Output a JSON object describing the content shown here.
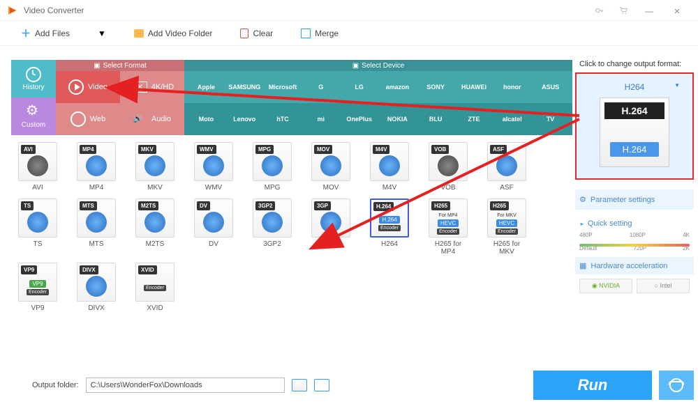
{
  "window": {
    "title": "Video Converter"
  },
  "toolbar": {
    "add_files": "Add Files",
    "add_folder": "Add Video Folder",
    "clear": "Clear",
    "merge": "Merge"
  },
  "sidebar": {
    "history": "History",
    "custom": "Custom"
  },
  "category_headers": {
    "format": "Select Format",
    "device": "Select Device"
  },
  "categories": {
    "video": "Video",
    "k4hd": "4K/HD",
    "web": "Web",
    "audio": "Audio"
  },
  "brands_row1": [
    "Apple",
    "SAMSUNG",
    "Microsoft",
    "G",
    "LG",
    "amazon",
    "SONY",
    "HUAWEI",
    "honor",
    "ASUS"
  ],
  "brands_row2": [
    "Moto",
    "Lenovo",
    "hTC",
    "mi",
    "OnePlus",
    "NOKIA",
    "BLU",
    "ZTE",
    "alcatel",
    "TV"
  ],
  "formats_row1": [
    {
      "badge": "AVI",
      "label": "AVI"
    },
    {
      "badge": "MP4",
      "label": "MP4"
    },
    {
      "badge": "MKV",
      "label": "MKV"
    },
    {
      "badge": "WMV",
      "label": "WMV"
    },
    {
      "badge": "MPG",
      "label": "MPG"
    },
    {
      "badge": "MOV",
      "label": "MOV"
    },
    {
      "badge": "M4V",
      "label": "M4V"
    },
    {
      "badge": "VOB",
      "label": "VOB"
    },
    {
      "badge": "ASF",
      "label": "ASF"
    },
    {
      "badge": "TS",
      "label": "TS"
    }
  ],
  "formats_row2": [
    {
      "badge": "MTS",
      "label": "MTS"
    },
    {
      "badge": "M2TS",
      "label": "M2TS"
    },
    {
      "badge": "DV",
      "label": "DV"
    },
    {
      "badge": "3GP2",
      "label": "3GP2"
    },
    {
      "badge": "3GP",
      "label": "3GP"
    },
    {
      "badge": "H.264",
      "label": "H264",
      "chip": "H.264",
      "enc": "Encoder",
      "selected": true
    },
    {
      "badge": "H265",
      "label": "H265 for MP4",
      "sub": "For MP4",
      "chip": "HEVC",
      "enc": "Encoder"
    },
    {
      "badge": "H265",
      "label": "H265 for MKV",
      "sub": "For MKV",
      "chip": "HEVC",
      "enc": "Encoder"
    },
    {
      "badge": "VP9",
      "label": "VP9",
      "chip": "VP9",
      "enc": "Encoder",
      "chipcolor": "#4aa84a"
    },
    {
      "badge": "DIVX",
      "label": "DIVX"
    }
  ],
  "formats_row3": [
    {
      "badge": "XVID",
      "label": "XVID",
      "enc": "Encoder"
    }
  ],
  "right_panel": {
    "title": "Click to change output format:",
    "selected": "H264",
    "big_top": "H.264",
    "big_bot": "H.264",
    "param_settings": "Parameter settings",
    "quick_setting": "Quick setting",
    "quality_labels_top": [
      "480P",
      "1080P",
      "4K"
    ],
    "quality_labels_bot": [
      "Default",
      "720P",
      "2K"
    ],
    "hw_accel": "Hardware acceleration",
    "nvidia": "NVIDIA",
    "intel": "Intel"
  },
  "bottom": {
    "output_folder_label": "Output folder:",
    "output_folder_path": "C:\\Users\\WonderFox\\Downloads",
    "run": "Run"
  }
}
